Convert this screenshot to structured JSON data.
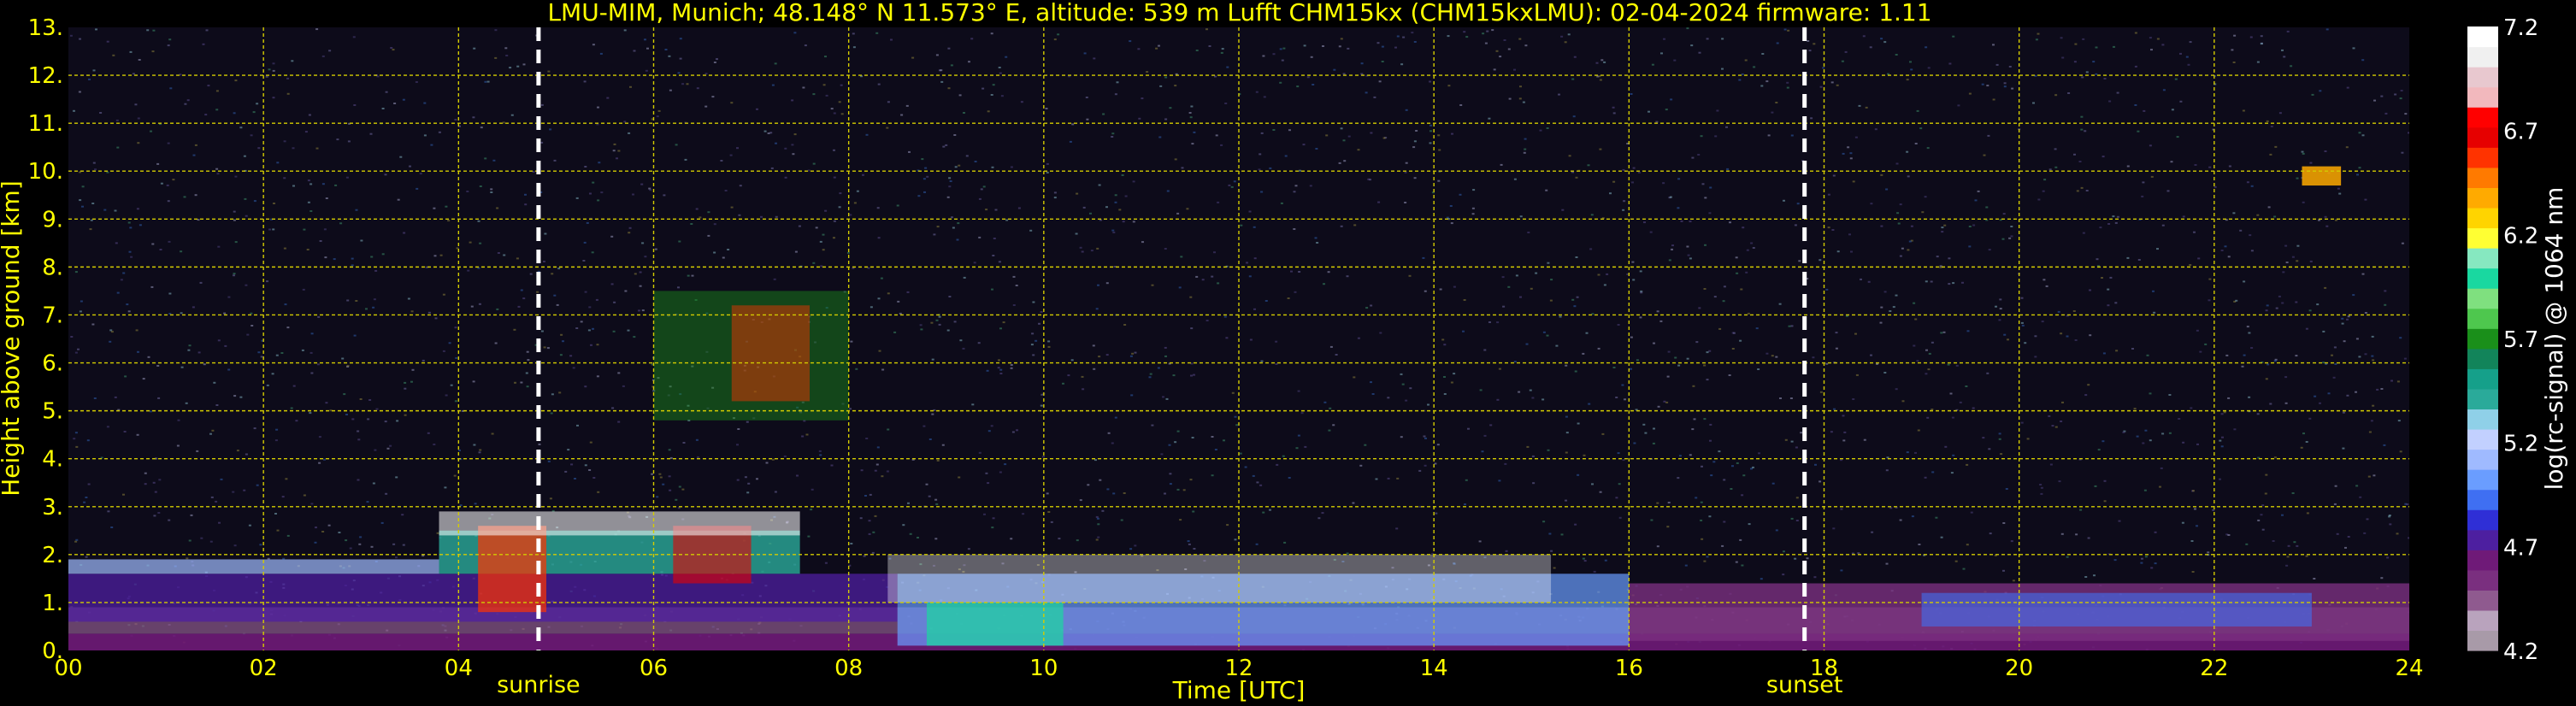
{
  "chart_data": {
    "type": "heatmap",
    "title": "LMU-MIM, Munich; 48.148° N 11.573° E, altitude: 539 m    Lufft CHM15kx (CHM15kxLMU): 02-04-2024    firmware: 1.11",
    "xlabel": "Time [UTC]",
    "ylabel": "Height above ground [km]",
    "xlim": [
      0,
      24
    ],
    "ylim": [
      0,
      13
    ],
    "x_ticks": [
      "00",
      "02",
      "04",
      "06",
      "08",
      "10",
      "12",
      "14",
      "16",
      "18",
      "20",
      "22",
      "24"
    ],
    "y_ticks": [
      "0.",
      "1.",
      "2.",
      "3.",
      "4.",
      "5.",
      "6.",
      "7.",
      "8.",
      "9.",
      "10.",
      "11.",
      "12.",
      "13."
    ],
    "grid": true,
    "colorbar": {
      "label": "log(rc-signal) @ 1064 nm",
      "range": [
        4.2,
        7.2
      ],
      "ticks": [
        "4.2",
        "4.7",
        "5.2",
        "5.7",
        "6.2",
        "6.7",
        "7.2"
      ],
      "colors": [
        "#a89aa8",
        "#b9a3bd",
        "#8f5a8f",
        "#7a2f7f",
        "#6f1a78",
        "#4d1fa0",
        "#2f2fd6",
        "#3f6ff2",
        "#6a9dff",
        "#9fbaff",
        "#c2d0ff",
        "#8fd0e8",
        "#2aaa9a",
        "#15a08a",
        "#12845a",
        "#1a8f1a",
        "#4ec74e",
        "#7fe07f",
        "#19d8a0",
        "#86e8c0",
        "#ffff33",
        "#ffd400",
        "#ffaa00",
        "#ff7a00",
        "#ff3300",
        "#e60000",
        "#ff0000",
        "#f2b8bd",
        "#e8c8cf",
        "#f0f0f0",
        "#ffffff"
      ]
    },
    "annotations": [
      {
        "label": "sunrise",
        "time": 4.82
      },
      {
        "label": "sunset",
        "time": 17.8
      }
    ],
    "features": [
      {
        "name": "boundary layer aerosol",
        "time_range": [
          0,
          24
        ],
        "height_range": [
          0,
          1.8
        ]
      },
      {
        "name": "cloud layer",
        "time_range": [
          3.8,
          7.5
        ],
        "height_range": [
          1.8,
          3.0
        ]
      },
      {
        "name": "mid-level cloud",
        "time_range": [
          6.0,
          8.0
        ],
        "height_range": [
          4.8,
          7.5
        ]
      },
      {
        "name": "high cloud",
        "time_range": [
          22.9,
          23.3
        ],
        "height_range": [
          9.7,
          10.1
        ]
      }
    ]
  }
}
